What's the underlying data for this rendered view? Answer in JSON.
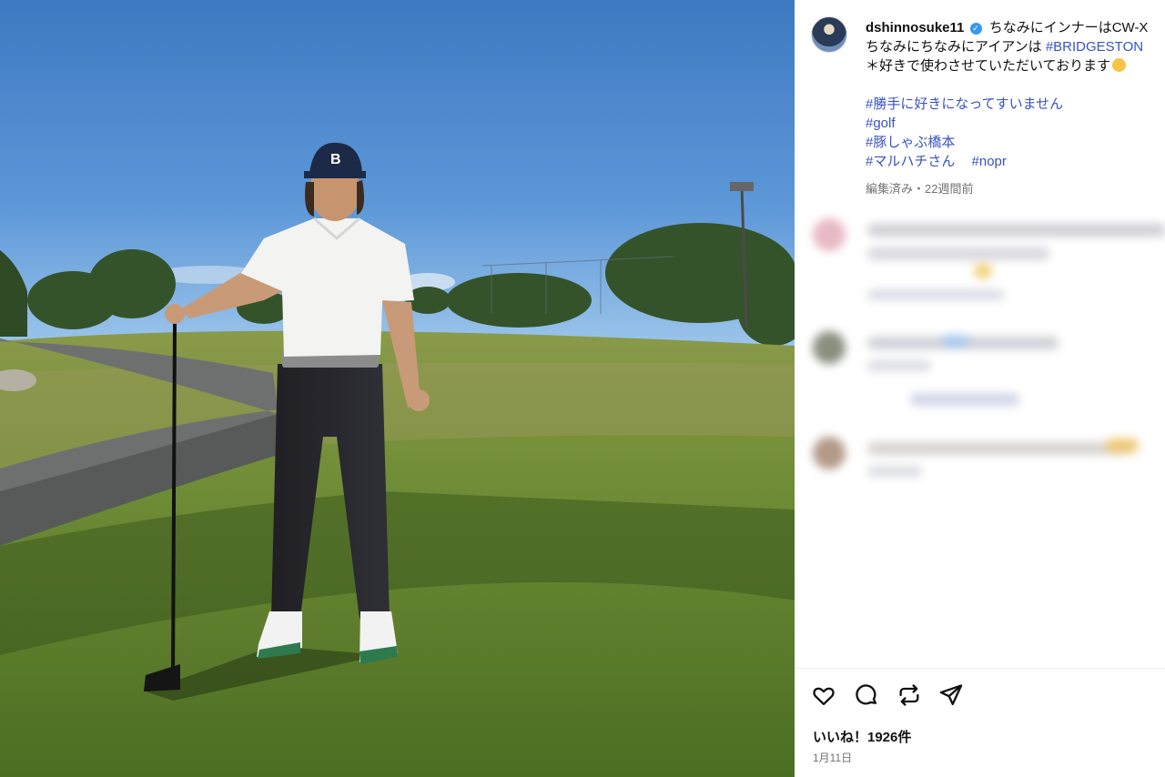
{
  "post": {
    "username": "dshinnosuke11",
    "caption_line1": "ちなみにインナーはCW-X",
    "caption_line2_prefix": "ちなみにちなみにアイアンは ",
    "caption_line2_tag": "#BRIDGESTON",
    "caption_line3": "＊好きで使わさせていただいております",
    "hashtags": [
      "#勝手に好きになってすいません",
      "#golf",
      "#豚しゃぶ橋本"
    ],
    "hashtag_last_a": "#マルハチさん",
    "hashtag_last_b": "#nopr",
    "meta": "編集済み・22週間前"
  },
  "actions": {
    "like_icon": "heart-icon",
    "comment_icon": "comment-icon",
    "repost_icon": "repost-icon",
    "share_icon": "send-icon"
  },
  "likes_text": "いいね！1926件",
  "date_text": "1月11日",
  "colors": {
    "link": "#3852c4",
    "meta": "#737373",
    "verified": "#3897f0"
  }
}
